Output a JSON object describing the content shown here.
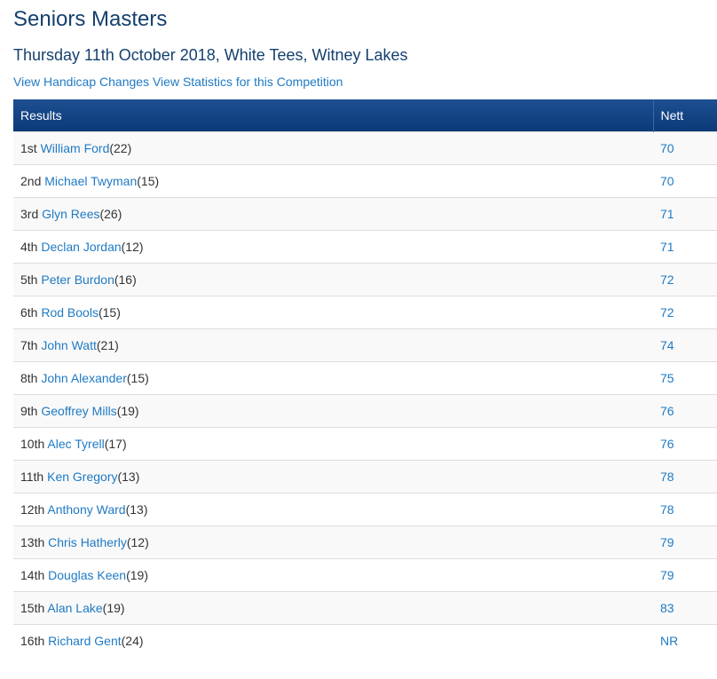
{
  "page": {
    "title": "Seniors Masters",
    "subtitle": "Thursday 11th October 2018, White Tees, Witney Lakes"
  },
  "links": {
    "handicap_changes": "View Handicap Changes",
    "statistics": "View Statistics for this Competition"
  },
  "colors": {
    "title": "#15406e",
    "link": "#1f7ac4",
    "header_bg": "#0c3a78",
    "row_stripe": "#f9f9f9"
  },
  "table": {
    "headers": {
      "results": "Results",
      "nett": "Nett"
    },
    "rows": [
      {
        "position": "1st",
        "name": "William Ford",
        "handicap": "(22)",
        "nett": "70"
      },
      {
        "position": "2nd",
        "name": "Michael Twyman",
        "handicap": "(15)",
        "nett": "70"
      },
      {
        "position": "3rd",
        "name": "Glyn Rees",
        "handicap": "(26)",
        "nett": "71"
      },
      {
        "position": "4th",
        "name": "Declan Jordan",
        "handicap": "(12)",
        "nett": "71"
      },
      {
        "position": "5th",
        "name": "Peter Burdon",
        "handicap": "(16)",
        "nett": "72"
      },
      {
        "position": "6th",
        "name": "Rod Bools",
        "handicap": "(15)",
        "nett": "72"
      },
      {
        "position": "7th",
        "name": "John Watt",
        "handicap": "(21)",
        "nett": "74"
      },
      {
        "position": "8th",
        "name": "John Alexander",
        "handicap": "(15)",
        "nett": "75"
      },
      {
        "position": "9th",
        "name": "Geoffrey Mills",
        "handicap": "(19)",
        "nett": "76"
      },
      {
        "position": "10th",
        "name": "Alec Tyrell",
        "handicap": "(17)",
        "nett": "76"
      },
      {
        "position": "11th",
        "name": "Ken Gregory",
        "handicap": "(13)",
        "nett": "78"
      },
      {
        "position": "12th",
        "name": "Anthony Ward",
        "handicap": "(13)",
        "nett": "78"
      },
      {
        "position": "13th",
        "name": "Chris Hatherly",
        "handicap": "(12)",
        "nett": "79"
      },
      {
        "position": "14th",
        "name": "Douglas Keen",
        "handicap": "(19)",
        "nett": "79"
      },
      {
        "position": "15th",
        "name": "Alan Lake",
        "handicap": "(19)",
        "nett": "83"
      },
      {
        "position": "16th",
        "name": "Richard Gent",
        "handicap": "(24)",
        "nett": "NR"
      }
    ]
  }
}
